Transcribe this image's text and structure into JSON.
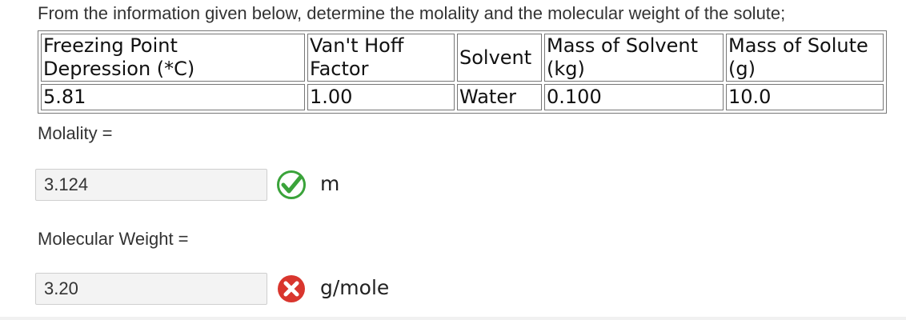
{
  "prompt": "From the information given below, determine the molality and the molecular weight of the solute;",
  "table": {
    "headers": [
      [
        "Freezing Point",
        "Depression (*C)"
      ],
      [
        "Van't Hoff",
        "Factor"
      ],
      [
        "Solvent"
      ],
      [
        "Mass of Solvent",
        "(kg)"
      ],
      [
        "Mass of Solute",
        "(g)"
      ]
    ],
    "row": [
      "5.81",
      "1.00",
      "Water",
      "0.100",
      "10.0"
    ]
  },
  "molality": {
    "label": "Molality =",
    "value": "3.124",
    "status": "correct",
    "status_icon": "check-icon",
    "unit": "m"
  },
  "molecular_weight": {
    "label": "Molecular Weight =",
    "value": "3.20",
    "status": "incorrect",
    "status_icon": "x-icon",
    "unit": "g/mole"
  },
  "colors": {
    "correct_green": "#3aa33a",
    "incorrect_red": "#d9362e"
  }
}
